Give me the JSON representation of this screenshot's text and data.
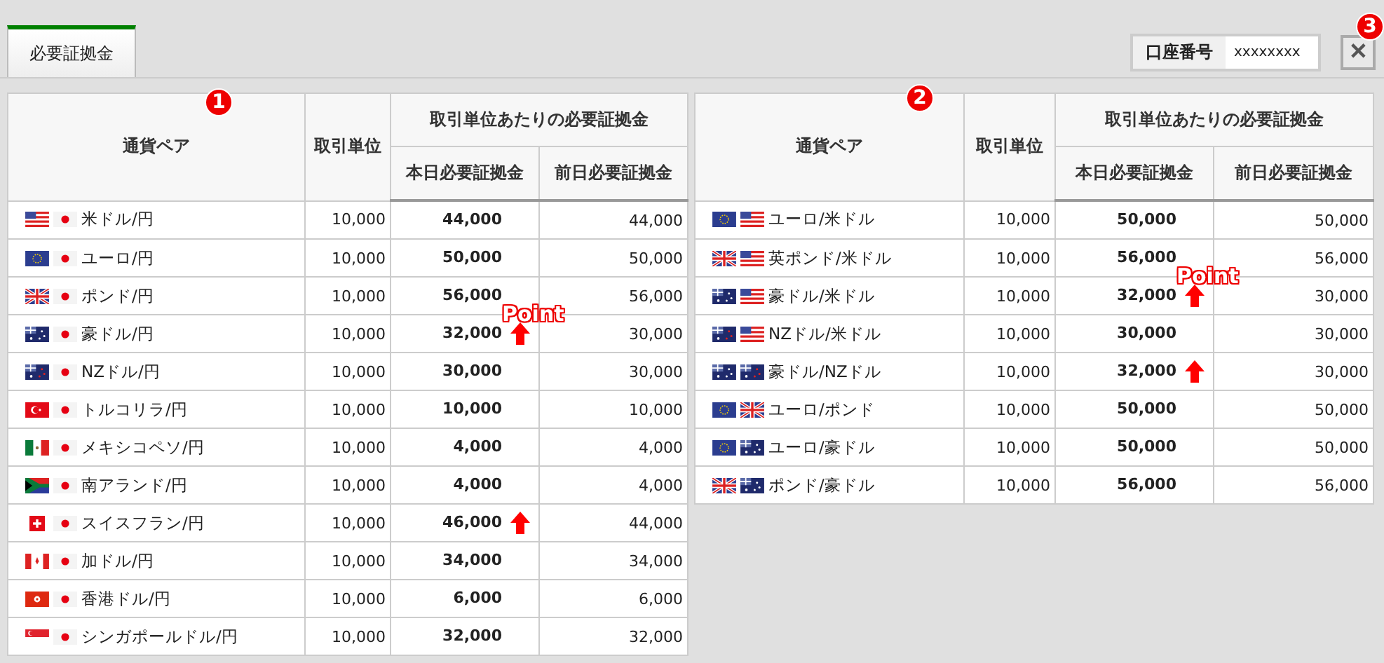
{
  "tabs": [
    {
      "label": "必要証拠金",
      "selected": true
    }
  ],
  "account": {
    "label": "口座番号",
    "value": "xxxxxxxx"
  },
  "close_button": {
    "label": "✕",
    "marker": "3"
  },
  "tables": [
    {
      "marker": "1",
      "headers": {
        "pair": "通貨ペア",
        "unit": "取引単位",
        "group": "取引単位あたりの必要証拠金",
        "today": "本日必要証拠金",
        "previous": "前日必要証拠金"
      },
      "rows": [
        {
          "flags": [
            {
              "kind": "us"
            },
            {
              "kind": "jp"
            }
          ],
          "pair": "米ドル/円",
          "unit": "10,000",
          "today": "44,000",
          "up": false,
          "previous": "44,000"
        },
        {
          "flags": [
            {
              "kind": "eu"
            },
            {
              "kind": "jp"
            }
          ],
          "pair": "ユーロ/円",
          "unit": "10,000",
          "today": "50,000",
          "up": false,
          "previous": "50,000"
        },
        {
          "flags": [
            {
              "kind": "gb"
            },
            {
              "kind": "jp"
            }
          ],
          "pair": "ポンド/円",
          "unit": "10,000",
          "today": "56,000",
          "up": false,
          "previous": "56,000"
        },
        {
          "flags": [
            {
              "kind": "au"
            },
            {
              "kind": "jp"
            }
          ],
          "pair": "豪ドル/円",
          "unit": "10,000",
          "today": "32,000",
          "up": true,
          "point": "Point",
          "previous": "30,000"
        },
        {
          "flags": [
            {
              "kind": "nz"
            },
            {
              "kind": "jp"
            }
          ],
          "pair": "NZドル/円",
          "unit": "10,000",
          "today": "30,000",
          "up": false,
          "previous": "30,000"
        },
        {
          "flags": [
            {
              "kind": "tr"
            },
            {
              "kind": "jp"
            }
          ],
          "pair": "トルコリラ/円",
          "unit": "10,000",
          "today": "10,000",
          "up": false,
          "previous": "10,000"
        },
        {
          "flags": [
            {
              "kind": "mx"
            },
            {
              "kind": "jp"
            }
          ],
          "pair": "メキシコペソ/円",
          "unit": "10,000",
          "today": "4,000",
          "up": false,
          "previous": "4,000"
        },
        {
          "flags": [
            {
              "kind": "za"
            },
            {
              "kind": "jp"
            }
          ],
          "pair": "南アランド/円",
          "unit": "10,000",
          "today": "4,000",
          "up": false,
          "previous": "4,000"
        },
        {
          "flags": [
            {
              "kind": "ch"
            },
            {
              "kind": "jp"
            }
          ],
          "pair": "スイスフラン/円",
          "unit": "10,000",
          "today": "46,000",
          "up": true,
          "previous": "44,000"
        },
        {
          "flags": [
            {
              "kind": "ca"
            },
            {
              "kind": "jp"
            }
          ],
          "pair": "加ドル/円",
          "unit": "10,000",
          "today": "34,000",
          "up": false,
          "previous": "34,000"
        },
        {
          "flags": [
            {
              "kind": "hk"
            },
            {
              "kind": "jp"
            }
          ],
          "pair": "香港ドル/円",
          "unit": "10,000",
          "today": "6,000",
          "up": false,
          "previous": "6,000"
        },
        {
          "flags": [
            {
              "kind": "sg"
            },
            {
              "kind": "jp"
            }
          ],
          "pair": "シンガポールドル/円",
          "unit": "10,000",
          "today": "32,000",
          "up": false,
          "previous": "32,000"
        }
      ]
    },
    {
      "marker": "2",
      "headers": {
        "pair": "通貨ペア",
        "unit": "取引単位",
        "group": "取引単位あたりの必要証拠金",
        "today": "本日必要証拠金",
        "previous": "前日必要証拠金"
      },
      "rows": [
        {
          "flags": [
            {
              "kind": "eu"
            },
            {
              "kind": "us"
            }
          ],
          "pair": "ユーロ/米ドル",
          "unit": "10,000",
          "today": "50,000",
          "up": false,
          "previous": "50,000"
        },
        {
          "flags": [
            {
              "kind": "gb"
            },
            {
              "kind": "us"
            }
          ],
          "pair": "英ポンド/米ドル",
          "unit": "10,000",
          "today": "56,000",
          "up": false,
          "previous": "56,000"
        },
        {
          "flags": [
            {
              "kind": "au"
            },
            {
              "kind": "us"
            }
          ],
          "pair": "豪ドル/米ドル",
          "unit": "10,000",
          "today": "32,000",
          "up": true,
          "point": "Point",
          "previous": "30,000"
        },
        {
          "flags": [
            {
              "kind": "nz"
            },
            {
              "kind": "us"
            }
          ],
          "pair": "NZドル/米ドル",
          "unit": "10,000",
          "today": "30,000",
          "up": false,
          "previous": "30,000"
        },
        {
          "flags": [
            {
              "kind": "au"
            },
            {
              "kind": "nz"
            }
          ],
          "pair": "豪ドル/NZドル",
          "unit": "10,000",
          "today": "32,000",
          "up": true,
          "previous": "30,000"
        },
        {
          "flags": [
            {
              "kind": "eu"
            },
            {
              "kind": "gb"
            }
          ],
          "pair": "ユーロ/ポンド",
          "unit": "10,000",
          "today": "50,000",
          "up": false,
          "previous": "50,000"
        },
        {
          "flags": [
            {
              "kind": "eu"
            },
            {
              "kind": "au"
            }
          ],
          "pair": "ユーロ/豪ドル",
          "unit": "10,000",
          "today": "50,000",
          "up": false,
          "previous": "50,000"
        },
        {
          "flags": [
            {
              "kind": "gb"
            },
            {
              "kind": "au"
            }
          ],
          "pair": "ポンド/豪ドル",
          "unit": "10,000",
          "today": "56,000",
          "up": false,
          "previous": "56,000"
        }
      ]
    }
  ]
}
